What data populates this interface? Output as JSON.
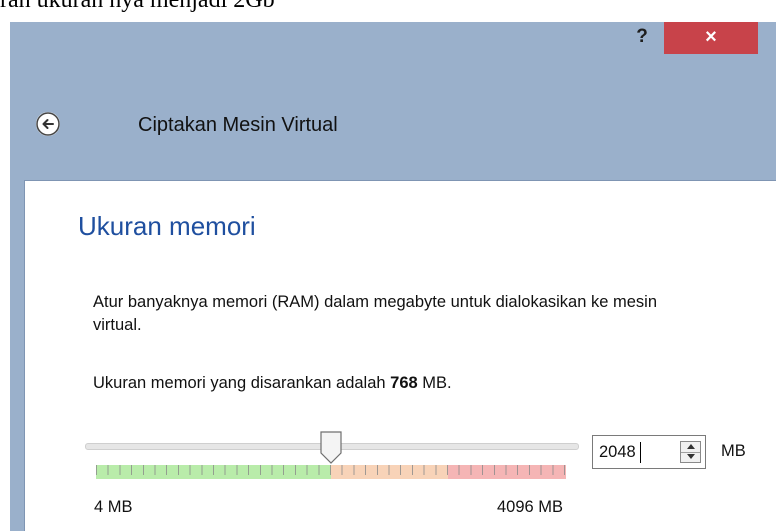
{
  "top_fragment": "ran ukuran hya menjadi 2Gb ",
  "window": {
    "help_label": "?",
    "close_label": "×",
    "title": "Ciptakan Mesin Virtual",
    "accent_title_color": "#1f4f9f",
    "close_color": "#c8434a",
    "titlebar_color": "#9ab0cb"
  },
  "icons": {
    "back": "back-arrow-icon"
  },
  "page": {
    "title": "Ukuran memori",
    "description": "Atur banyaknya memori (RAM) dalam megabyte untuk dialokasikan ke mesin virtual.",
    "recommend_prefix": "Ukuran memori yang disarankan adalah ",
    "recommend_value": "768",
    "recommend_unit": " MB."
  },
  "memory": {
    "min_mb": 4,
    "max_mb": 4096,
    "value_mb": 2048,
    "min_label": "4 MB",
    "max_label": "4096 MB",
    "input_value": "2048",
    "unit": "MB",
    "zones": [
      {
        "name": "safe",
        "from_mb": 4,
        "to_mb": 2048,
        "color": "#b9ecaa"
      },
      {
        "name": "warning",
        "from_mb": 2048,
        "to_mb": 3072,
        "color": "#f8d3b8"
      },
      {
        "name": "danger",
        "from_mb": 3072,
        "to_mb": 4096,
        "color": "#f5b5b5"
      }
    ]
  }
}
